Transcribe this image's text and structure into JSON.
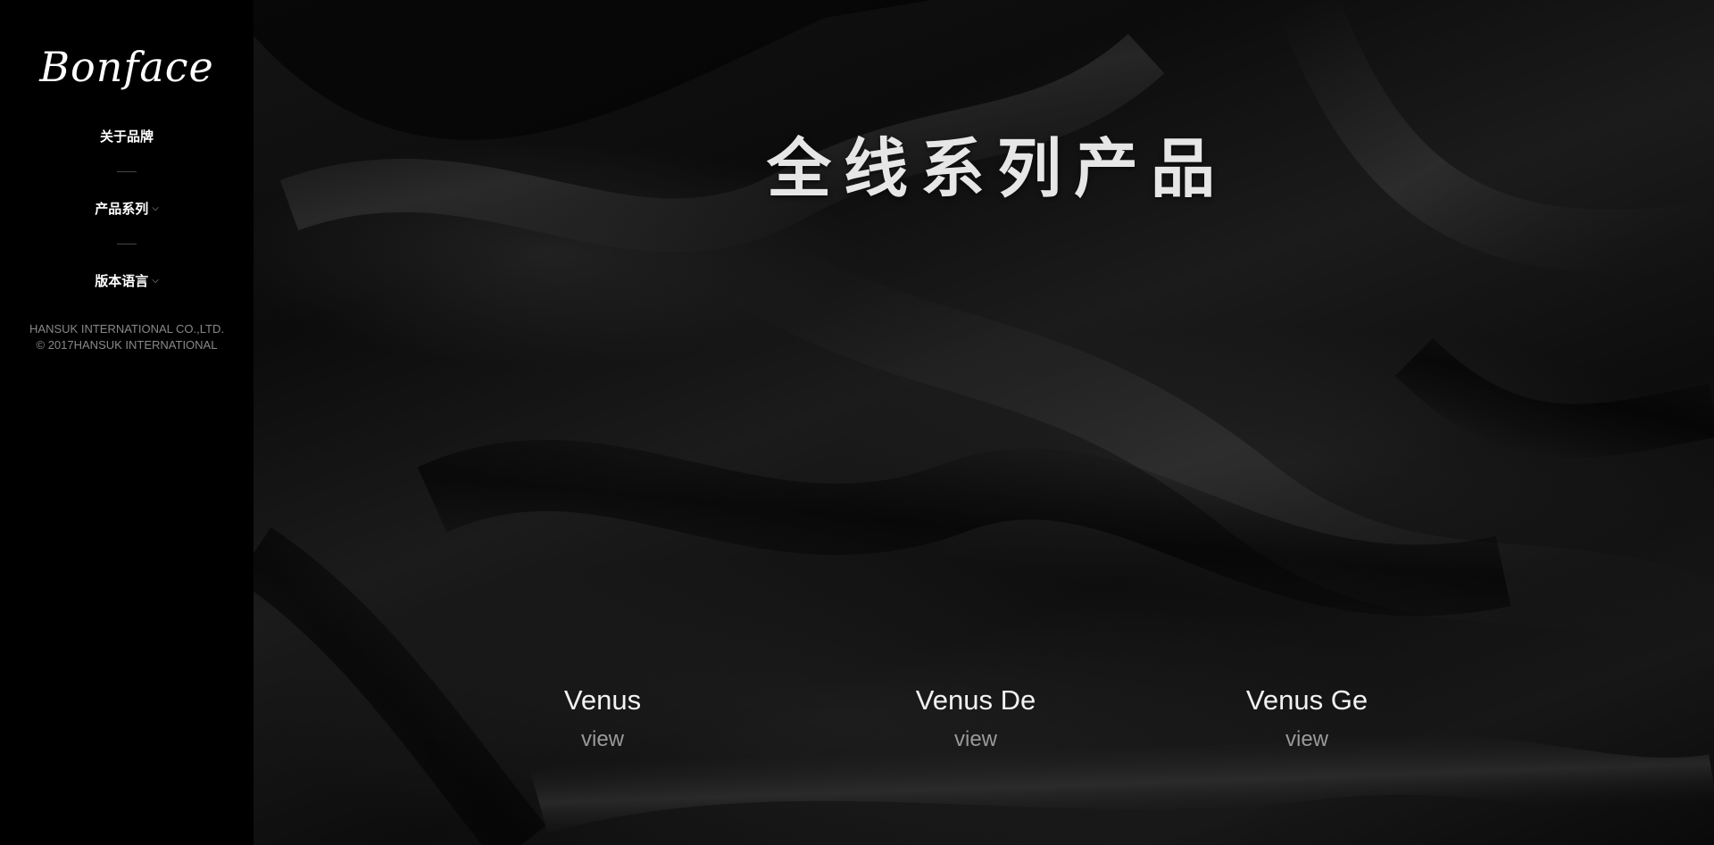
{
  "sidebar": {
    "logo": "Bonface",
    "nav": [
      {
        "label": "关于品牌",
        "chevron": ""
      },
      {
        "label": "产品系列",
        "chevron": "⌵"
      },
      {
        "label": "版本语言",
        "chevron": "⌵"
      }
    ],
    "copyright_line1": "HANSUK INTERNATIONAL CO.,LTD.",
    "copyright_line2": "© 2017HANSUK INTERNATIONAL"
  },
  "main": {
    "title": "全线系列产品",
    "products": [
      {
        "name": "Venus",
        "view": "view"
      },
      {
        "name": "Venus De",
        "view": "view"
      },
      {
        "name": "Venus Ge",
        "view": "view"
      }
    ]
  },
  "colors": {
    "background": "#000000",
    "text": "#ffffff",
    "muted": "#888888"
  }
}
